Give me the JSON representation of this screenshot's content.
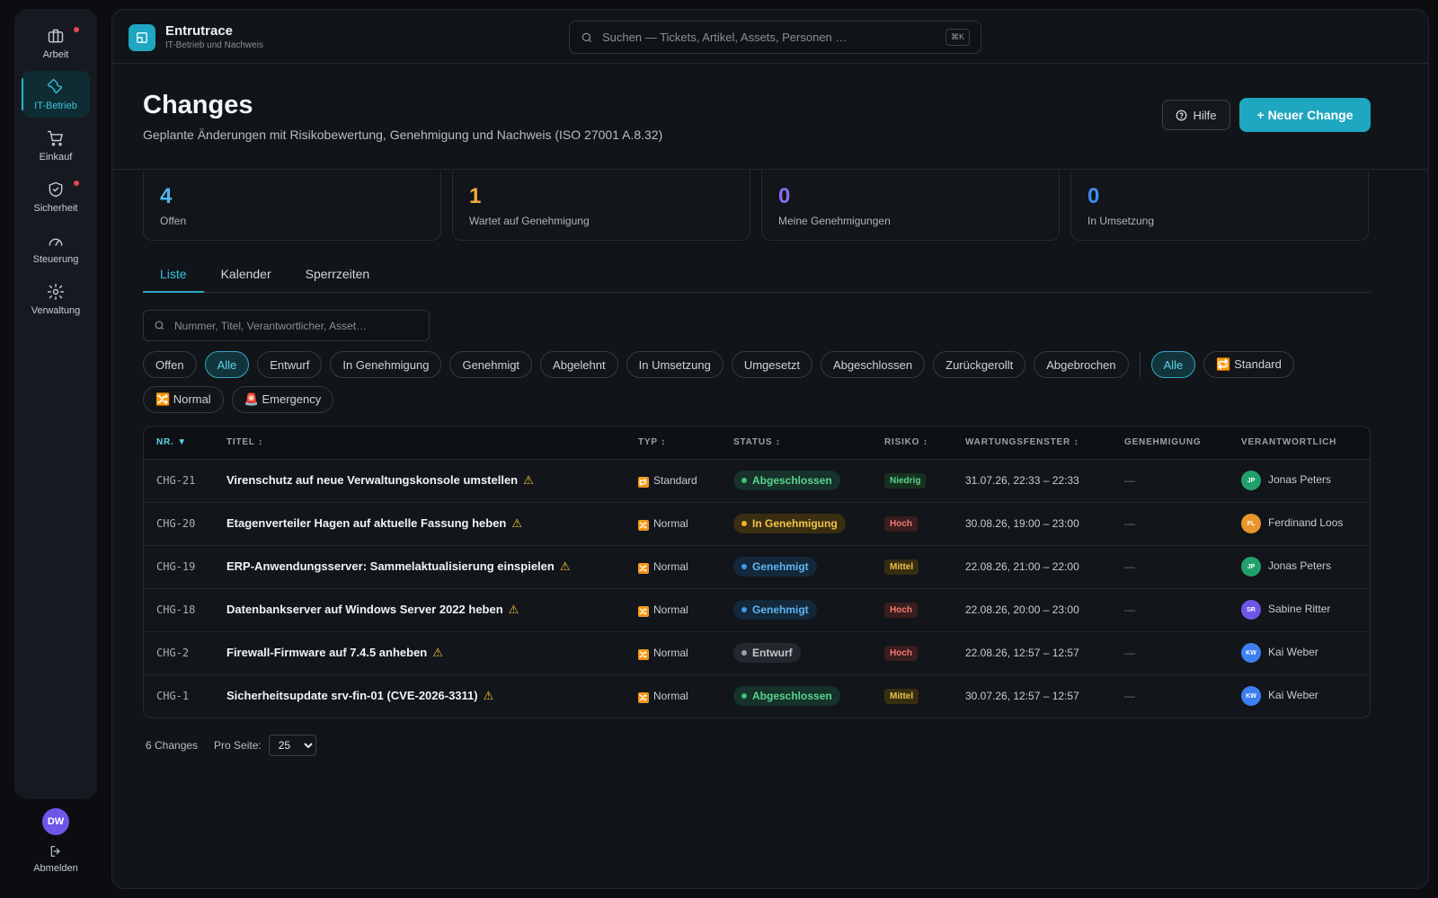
{
  "sidebar": {
    "items": [
      {
        "label": "Arbeit",
        "icon": "briefcase-icon"
      },
      {
        "label": "IT-Betrieb",
        "icon": "wrench-icon"
      },
      {
        "label": "Einkauf",
        "icon": "cart-icon"
      },
      {
        "label": "Sicherheit",
        "icon": "shield-icon"
      },
      {
        "label": "Steuerung",
        "icon": "gauge-icon"
      },
      {
        "label": "Verwaltung",
        "icon": "gear-icon"
      }
    ],
    "user_initials": "DW",
    "logout_label": "Abmelden"
  },
  "app": {
    "name": "Entrutrace",
    "subtitle": "IT-Betrieb und Nachweis",
    "search_placeholder": "Suchen — Tickets, Artikel, Assets, Personen …",
    "search_shortcut": "⌘K"
  },
  "page": {
    "title": "Changes",
    "subtitle": "Geplante Änderungen mit Risikobewertung, Genehmigung und Nachweis (ISO 27001 A.8.32)",
    "help_label": "Hilfe",
    "new_label": "+ Neuer Change"
  },
  "stats": [
    {
      "value": "4",
      "label": "Offen",
      "color": "#4fb7f0"
    },
    {
      "value": "1",
      "label": "Wartet auf Genehmigung",
      "color": "#f0a93a"
    },
    {
      "value": "0",
      "label": "Meine Genehmigungen",
      "color": "#8b6cf2"
    },
    {
      "value": "0",
      "label": "In Umsetzung",
      "color": "#3d8ff0"
    }
  ],
  "tabs": [
    "Liste",
    "Kalender",
    "Sperrzeiten"
  ],
  "list_search_placeholder": "Nummer, Titel, Verantwortlicher, Asset…",
  "status_filters": [
    "Offen",
    "Alle",
    "Entwurf",
    "In Genehmigung",
    "Genehmigt",
    "Abgelehnt",
    "In Umsetzung",
    "Umgesetzt",
    "Abgeschlossen",
    "Zurückgerollt",
    "Abgebrochen"
  ],
  "type_filters": [
    "Alle",
    "🔁 Standard",
    "🔀 Normal",
    "🚨 Emergency"
  ],
  "table": {
    "headers": [
      "NR. ▼",
      "TITEL ↕",
      "TYP ↕",
      "STATUS ↕",
      "RISIKO ↕",
      "WARTUNGSFENSTER ↕",
      "GENEHMIGUNG",
      "VERANTWORTLICH"
    ],
    "rows": [
      {
        "nr": "CHG-21",
        "title": "Virenschutz auf neue Verwaltungskonsole umstellen",
        "type": "Standard",
        "type_icon": "🔁",
        "status": "Abgeschlossen",
        "status_kind": "done",
        "risk": "Niedrig",
        "risk_kind": "low",
        "window": "31.07.26, 22:33 – 22:33",
        "approval": "—",
        "owner": "Jonas Peters",
        "initials": "JP",
        "avatar_color": "#22a06b"
      },
      {
        "nr": "CHG-20",
        "title": "Etagenverteiler Hagen auf aktuelle Fassung heben",
        "type": "Normal",
        "type_icon": "🔀",
        "status": "In Genehmigung",
        "status_kind": "wait",
        "risk": "Hoch",
        "risk_kind": "high",
        "window": "30.08.26, 19:00 – 23:00",
        "approval": "—",
        "owner": "Ferdinand Loos",
        "initials": "FL",
        "avatar_color": "#e8962e"
      },
      {
        "nr": "CHG-19",
        "title": "ERP-Anwendungsserver: Sammelaktualisierung einspielen",
        "type": "Normal",
        "type_icon": "🔀",
        "status": "Genehmigt",
        "status_kind": "appr",
        "risk": "Mittel",
        "risk_kind": "mid",
        "window": "22.08.26, 21:00 – 22:00",
        "approval": "—",
        "owner": "Jonas Peters",
        "initials": "JP",
        "avatar_color": "#22a06b"
      },
      {
        "nr": "CHG-18",
        "title": "Datenbankserver auf Windows Server 2022 heben",
        "type": "Normal",
        "type_icon": "🔀",
        "status": "Genehmigt",
        "status_kind": "appr",
        "risk": "Hoch",
        "risk_kind": "high",
        "window": "22.08.26, 20:00 – 23:00",
        "approval": "—",
        "owner": "Sabine Ritter",
        "initials": "SR",
        "avatar_color": "#6e56e8"
      },
      {
        "nr": "CHG-2",
        "title": "Firewall-Firmware auf 7.4.5 anheben",
        "type": "Normal",
        "type_icon": "🔀",
        "status": "Entwurf",
        "status_kind": "draft",
        "risk": "Hoch",
        "risk_kind": "high",
        "window": "22.08.26, 12:57 – 12:57",
        "approval": "—",
        "owner": "Kai Weber",
        "initials": "KW",
        "avatar_color": "#3d7ff0"
      },
      {
        "nr": "CHG-1",
        "title": "Sicherheitsupdate srv-fin-01 (CVE-2026-3311)",
        "type": "Normal",
        "type_icon": "🔀",
        "status": "Abgeschlossen",
        "status_kind": "done",
        "risk": "Mittel",
        "risk_kind": "mid",
        "window": "30.07.26, 12:57 – 12:57",
        "approval": "—",
        "owner": "Kai Weber",
        "initials": "KW",
        "avatar_color": "#3d7ff0"
      }
    ]
  },
  "footer": {
    "count_label": "6 Changes",
    "per_page_label": "Pro Seite:",
    "per_page_value": "25"
  }
}
